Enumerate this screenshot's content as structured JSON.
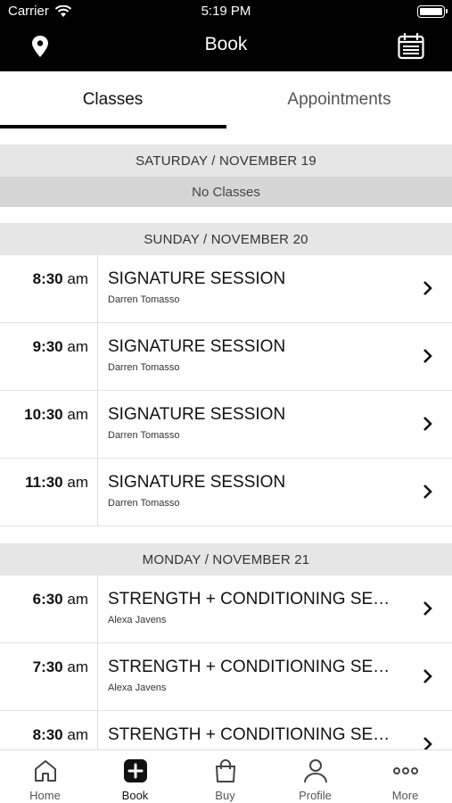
{
  "status_bar": {
    "carrier": "Carrier",
    "time": "5:19 PM"
  },
  "nav": {
    "title": "Book",
    "left_icon": "location-pin-icon",
    "right_icon": "calendar-icon"
  },
  "tabs": [
    {
      "label": "Classes",
      "active": true
    },
    {
      "label": "Appointments",
      "active": false
    }
  ],
  "days": [
    {
      "header": "SATURDAY / NOVEMBER 19",
      "empty_text": "No Classes",
      "classes": []
    },
    {
      "header": "SUNDAY / NOVEMBER 20",
      "classes": [
        {
          "time": "8:30",
          "period": "am",
          "name": "SIGNATURE SESSION",
          "instructor": "Darren Tomasso"
        },
        {
          "time": "9:30",
          "period": "am",
          "name": "SIGNATURE SESSION",
          "instructor": "Darren Tomasso"
        },
        {
          "time": "10:30",
          "period": "am",
          "name": "SIGNATURE SESSION",
          "instructor": "Darren Tomasso"
        },
        {
          "time": "11:30",
          "period": "am",
          "name": "SIGNATURE SESSION",
          "instructor": "Darren Tomasso"
        }
      ]
    },
    {
      "header": "MONDAY / NOVEMBER 21",
      "classes": [
        {
          "time": "6:30",
          "period": "am",
          "name": "STRENGTH + CONDITIONING SE…",
          "instructor": "Alexa Javens"
        },
        {
          "time": "7:30",
          "period": "am",
          "name": "STRENGTH + CONDITIONING SE…",
          "instructor": "Alexa Javens"
        },
        {
          "time": "8:30",
          "period": "am",
          "name": "STRENGTH + CONDITIONING SE…",
          "instructor": ""
        }
      ]
    }
  ],
  "tabbar": [
    {
      "label": "Home",
      "icon": "home-icon",
      "active": false
    },
    {
      "label": "Book",
      "icon": "plus-square-icon",
      "active": true
    },
    {
      "label": "Buy",
      "icon": "shopping-bag-icon",
      "active": false
    },
    {
      "label": "Profile",
      "icon": "person-icon",
      "active": false
    },
    {
      "label": "More",
      "icon": "more-dots-icon",
      "active": false
    }
  ]
}
